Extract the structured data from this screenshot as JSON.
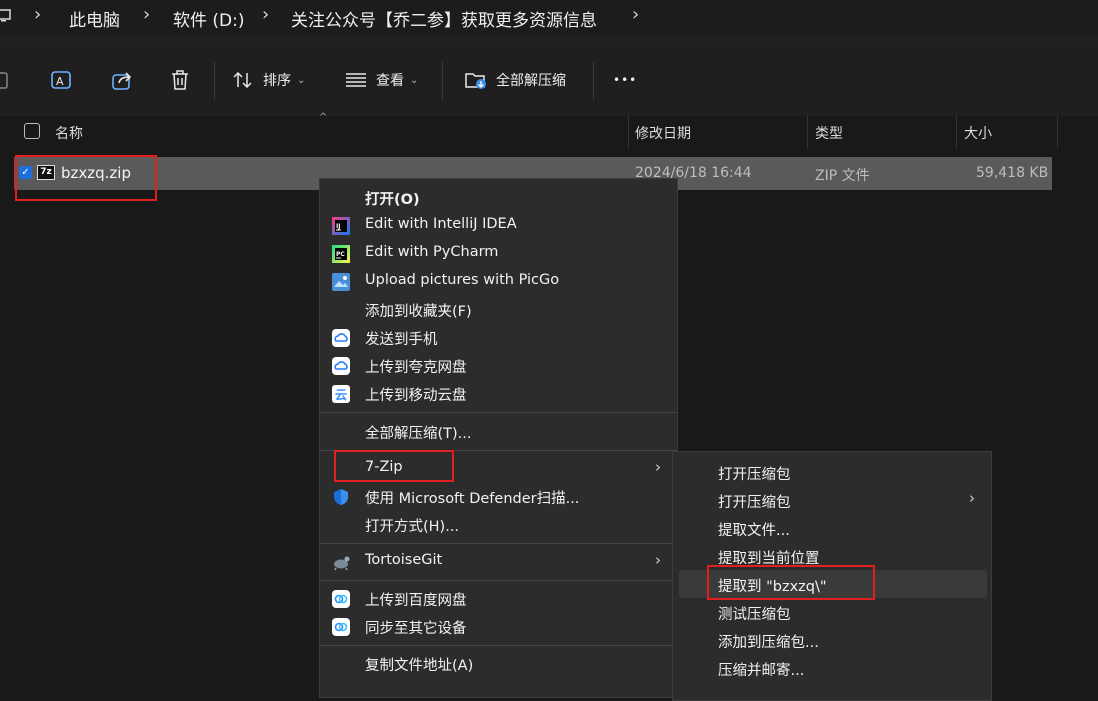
{
  "breadcrumb": {
    "items": [
      "此电脑",
      "软件 (D:)",
      "关注公众号【乔二参】获取更多资源信息"
    ]
  },
  "toolbar": {
    "sort_label": "排序",
    "view_label": "查看",
    "extract_all_label": "全部解压缩",
    "more_label": "•••"
  },
  "columns": {
    "name": "名称",
    "modified": "修改日期",
    "type": "类型",
    "size": "大小"
  },
  "file": {
    "name": "bzxzq.zip",
    "modified": "2024/6/18 16:44",
    "type": "ZIP 文件",
    "size": "59,418 KB",
    "icon_text": "7z",
    "checked": true
  },
  "context_menu": {
    "open": "打开(O)",
    "intellij": "Edit with IntelliJ IDEA",
    "pycharm": "Edit with PyCharm",
    "picgo": "Upload pictures with PicGo",
    "favorites": "添加到收藏夹(F)",
    "send_phone": "发送到手机",
    "quark": "上传到夸克网盘",
    "mobile_cloud": "上传到移动云盘",
    "extract_all": "全部解压缩(T)...",
    "sevenzip": "7-Zip",
    "defender": "使用 Microsoft Defender扫描...",
    "open_with": "打开方式(H)...",
    "tortoisegit": "TortoiseGit",
    "baidu": "上传到百度网盘",
    "sync": "同步至其它设备",
    "copy_path": "复制文件地址(A)"
  },
  "submenu_7zip": {
    "open_archive": "打开压缩包",
    "open_archive_sub": "打开压缩包",
    "extract_files": "提取文件...",
    "extract_here": "提取到当前位置",
    "extract_to": "提取到 \"bzxzq\\\"",
    "test_archive": "测试压缩包",
    "add_to_archive": "添加到压缩包...",
    "compress_email": "压缩并邮寄..."
  },
  "colors": {
    "highlight_box": "#e02020",
    "selected_row": "#5a5a5a",
    "menu_bg": "#2c2c2c"
  }
}
